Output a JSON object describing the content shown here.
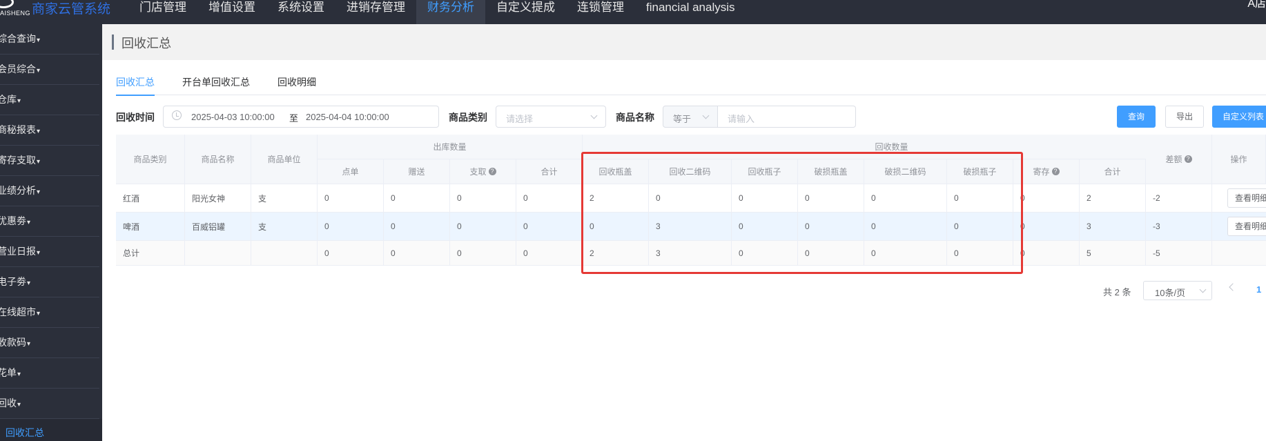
{
  "brand": {
    "subtitle": "AISHENG",
    "title": "商家云管系统"
  },
  "nav": [
    "门店管理",
    "增值设置",
    "系统设置",
    "进销存管理",
    "财务分析",
    "自定义提成",
    "连锁管理",
    "financial analysis"
  ],
  "user": {
    "line1": "",
    "line2": "A店"
  },
  "sidebar": {
    "items": [
      "综合查询",
      "会员综合",
      "仓库",
      "商秘报表",
      "寄存支取",
      "业绩分析",
      "优惠劵",
      "营业日报",
      "电子劵",
      "在线超市",
      "收款码",
      "花单",
      "回收"
    ],
    "active_sub": "回收汇总"
  },
  "page_title": "回收汇总",
  "tabs": [
    "回收汇总",
    "开台单回收汇总",
    "回收明细"
  ],
  "filter": {
    "time_label": "回收时间",
    "date_start": "2025-04-03 10:00:00",
    "date_sep": "至",
    "date_end": "2025-04-04 10:00:00",
    "category_label": "商品类别",
    "category_placeholder": "请选择",
    "name_label": "商品名称",
    "compare_value": "等于",
    "name_placeholder": "请输入",
    "query_btn": "查询",
    "export_btn": "导出",
    "custom_btn": "自定义列表"
  },
  "table": {
    "group_out": "出库数量",
    "group_recycle": "回收数量",
    "headers": [
      "商品类别",
      "商品名称",
      "商品单位",
      "点单",
      "赠送",
      "支取",
      "合计",
      "回收瓶盖",
      "回收二维码",
      "回收瓶子",
      "破损瓶盖",
      "破损二维码",
      "破损瓶子",
      "寄存",
      "合计",
      "差额",
      "操作"
    ],
    "rows": [
      [
        "红酒",
        "阳光女神",
        "支",
        "0",
        "0",
        "0",
        "0",
        "2",
        "0",
        "0",
        "0",
        "0",
        "0",
        "0",
        "2",
        "-2"
      ],
      [
        "啤酒",
        "百威铝罐",
        "支",
        "0",
        "0",
        "0",
        "0",
        "0",
        "3",
        "0",
        "0",
        "0",
        "0",
        "0",
        "3",
        "-3"
      ]
    ],
    "total_row": [
      "总计",
      "",
      "",
      "0",
      "0",
      "0",
      "0",
      "2",
      "3",
      "0",
      "0",
      "0",
      "0",
      "0",
      "5",
      "-5"
    ],
    "view_btn": "查看明细"
  },
  "pagination": {
    "total": "共 2 条",
    "page_size": "10条/页",
    "current_page": "1"
  }
}
